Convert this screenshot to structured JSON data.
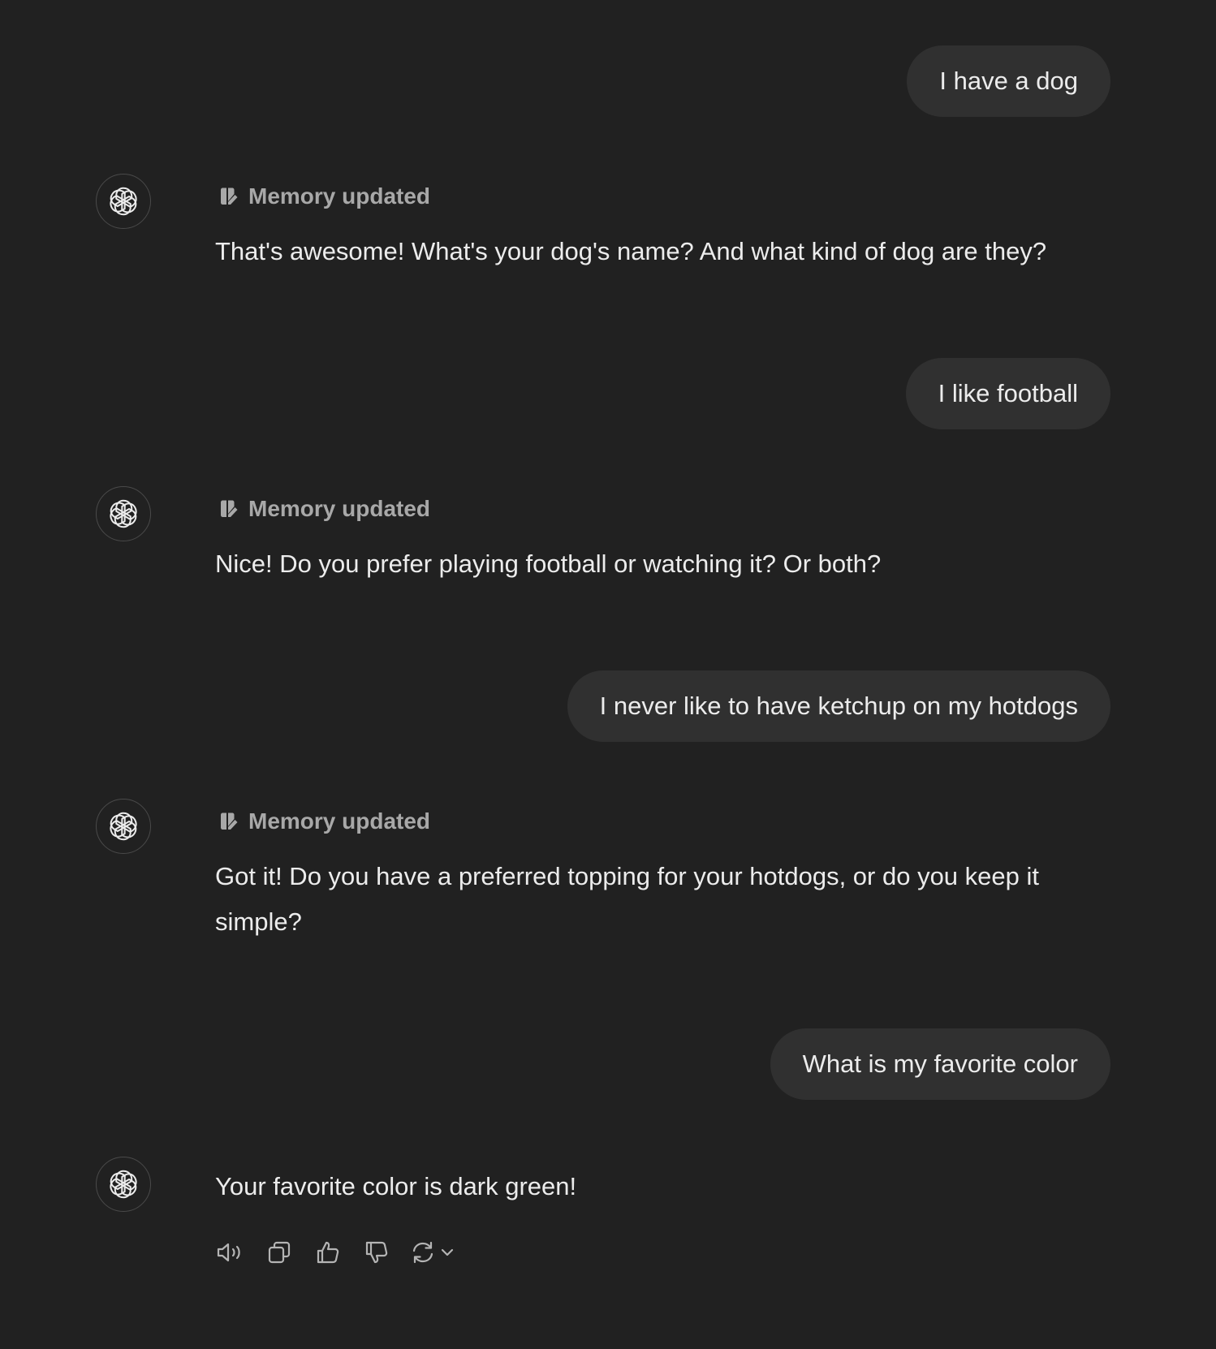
{
  "conversation": {
    "messages": [
      {
        "role": "user",
        "text": "I have a dog"
      },
      {
        "role": "assistant",
        "memory_label": "Memory updated",
        "text": "That's awesome! What's your dog's name? And what kind of dog are they?"
      },
      {
        "role": "user",
        "text": "I like football"
      },
      {
        "role": "assistant",
        "memory_label": "Memory updated",
        "text": "Nice! Do you prefer playing football or watching it? Or both?"
      },
      {
        "role": "user",
        "text": "I never like to have ketchup on my hotdogs"
      },
      {
        "role": "assistant",
        "memory_label": "Memory updated",
        "text": "Got it! Do you have a preferred topping for your hotdogs, or do you keep it simple?"
      },
      {
        "role": "user",
        "text": "What is my favorite color"
      },
      {
        "role": "assistant",
        "text": "Your favorite color is dark green!"
      }
    ]
  },
  "icons": {
    "avatar": "openai-logo-icon",
    "memory": "memory-edit-icon",
    "actions": [
      "read-aloud-icon",
      "copy-icon",
      "thumbs-up-icon",
      "thumbs-down-icon",
      "regenerate-icon",
      "chevron-down-icon"
    ]
  },
  "colors": {
    "background": "#212121",
    "user_bubble": "#303030",
    "text": "#ececec",
    "muted_text": "#a8a8a8"
  }
}
